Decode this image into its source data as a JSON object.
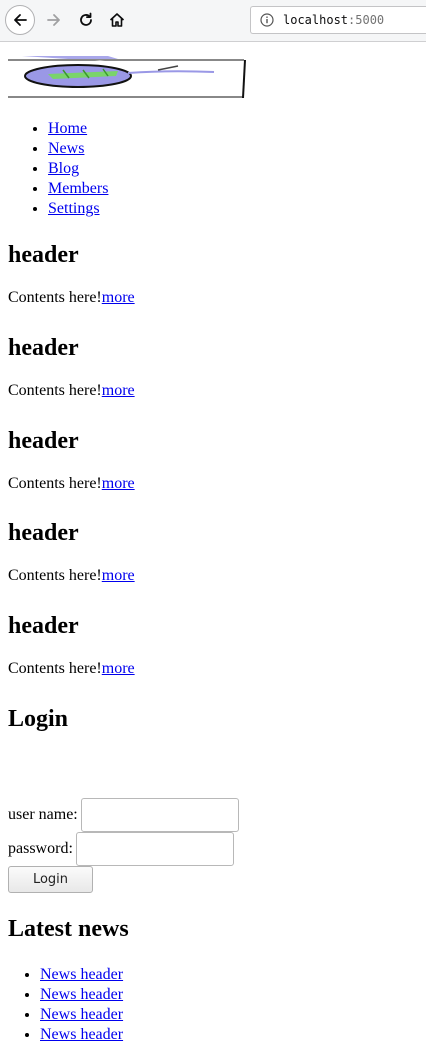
{
  "browser": {
    "url_host": "localhost",
    "url_port": ":5000"
  },
  "menu": {
    "items": [
      "Home",
      "News",
      "Blog",
      "Members",
      "Settings"
    ]
  },
  "articles": [
    {
      "header": "header",
      "contents": "Contents here!",
      "more": "more"
    },
    {
      "header": "header",
      "contents": "Contents here!",
      "more": "more"
    },
    {
      "header": "header",
      "contents": "Contents here!",
      "more": "more"
    },
    {
      "header": "header",
      "contents": "Contents here!",
      "more": "more"
    },
    {
      "header": "header",
      "contents": "Contents here!",
      "more": "more"
    }
  ],
  "login": {
    "title": "Login",
    "username_label": "user name:",
    "password_label": "password:",
    "username_value": "",
    "password_value": "",
    "button_label": "Login"
  },
  "latest_news": {
    "title": "Latest news",
    "items": [
      "News header",
      "News header",
      "News header",
      "News header"
    ]
  },
  "colors": {
    "link": "#0000ee",
    "logo_fill": "#9a98e6",
    "logo_accent": "#7ad46a"
  }
}
